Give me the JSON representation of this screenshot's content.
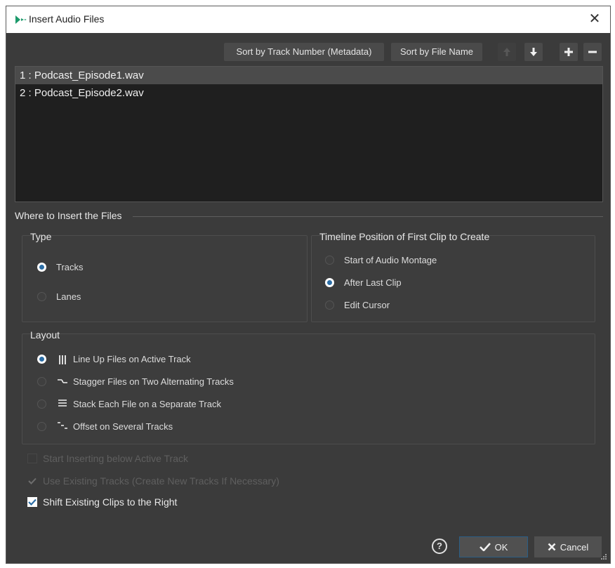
{
  "window": {
    "title": "Insert Audio Files",
    "close_glyph": "✕"
  },
  "toolbar": {
    "sort_track_number": "Sort by Track Number (Metadata)",
    "sort_file_name": "Sort by File Name"
  },
  "files": [
    {
      "label": "1 : Podcast_Episode1.wav",
      "selected": true
    },
    {
      "label": "2 : Podcast_Episode2.wav",
      "selected": false
    }
  ],
  "insert_section": {
    "label": "Where to Insert the Files",
    "type": {
      "title": "Type",
      "options": [
        {
          "label": "Tracks",
          "selected": true
        },
        {
          "label": "Lanes",
          "selected": false
        }
      ]
    },
    "timeline": {
      "title": "Timeline Position of First Clip to Create",
      "options": [
        {
          "label": "Start of Audio Montage",
          "selected": false
        },
        {
          "label": "After Last Clip",
          "selected": true
        },
        {
          "label": "Edit Cursor",
          "selected": false
        }
      ]
    },
    "layout": {
      "title": "Layout",
      "options": [
        {
          "label": "Line Up Files on Active Track",
          "selected": true,
          "icon": "line-up-icon"
        },
        {
          "label": "Stagger Files on Two Alternating Tracks",
          "selected": false,
          "icon": "stagger-icon"
        },
        {
          "label": "Stack Each File on a Separate Track",
          "selected": false,
          "icon": "stack-icon"
        },
        {
          "label": "Offset on Several Tracks",
          "selected": false,
          "icon": "offset-icon"
        }
      ]
    }
  },
  "options": [
    {
      "label": "Start Inserting below Active Track",
      "checked": false,
      "enabled": false
    },
    {
      "label": "Use Existing Tracks (Create New Tracks If Necessary)",
      "checked": true,
      "enabled": false
    },
    {
      "label": "Shift Existing Clips to the Right",
      "checked": true,
      "enabled": true
    }
  ],
  "footer": {
    "help_glyph": "?",
    "ok_label": "OK",
    "cancel_label": "Cancel"
  },
  "colors": {
    "background": "#3b3b3b",
    "list_background": "#1f1f1f",
    "accent": "#2c6ea6"
  }
}
